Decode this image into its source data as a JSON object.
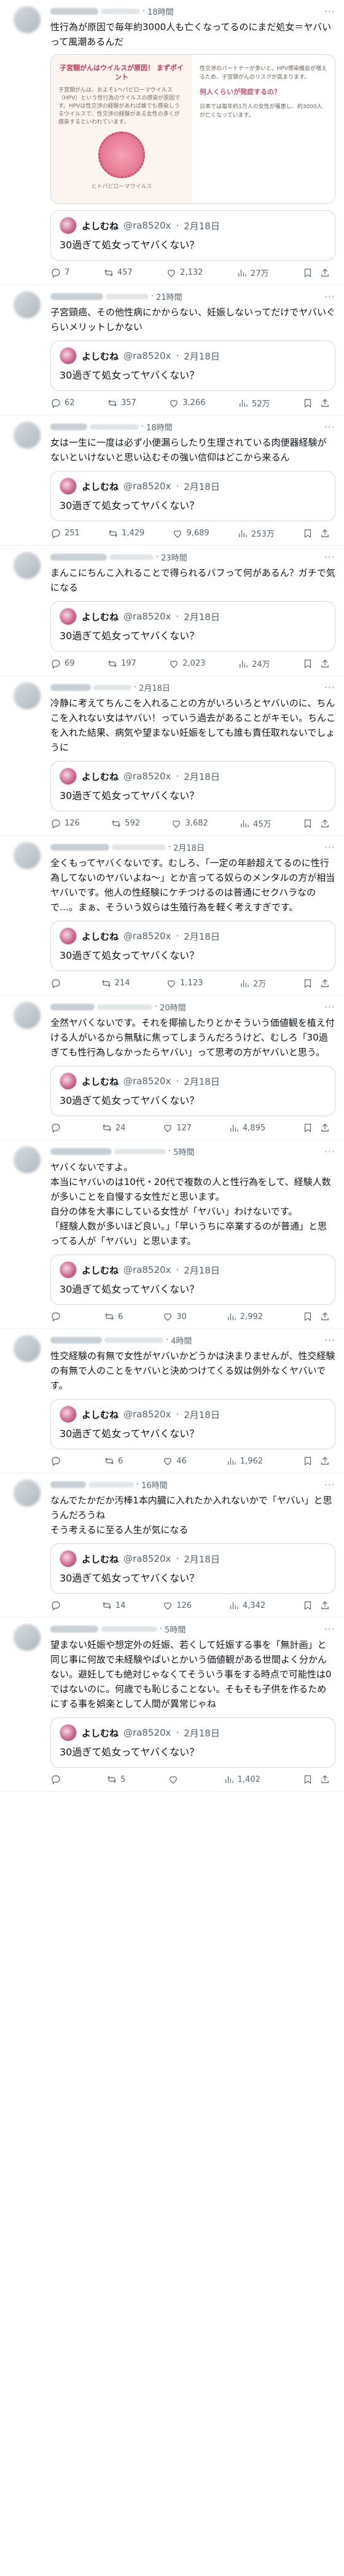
{
  "ui": {
    "quoted_name": "よしむね",
    "quoted_handle": "@ra8520x",
    "quoted_date": "2月18日",
    "quoted_text": "30過ぎて処女ってヤバくない？",
    "separator": "·"
  },
  "image_card": {
    "left_title": "子宮頸がんはウイルスが原因！\nまずポイント",
    "left_body": "子宮頸がんは、およそ1ヘパビローマウイルス（HPV）という性行為のウイルスの感染が原因です。HPVは性交渉の経験があれば誰でも感染しうるウイルスで、性交渉の経験がある女性の多くが感染するといわれています。",
    "caption": "ヒトパピローマウイルス",
    "right_body_1": "性交渉のパートナーが多いと、HPV感染機会が増えるため、子宮頸がんのリスクが高まります。",
    "right_pink": "何人くらいが発症するの？",
    "right_body_2": "日本では毎年約1万人の女性が罹患し、約3000人が亡くなっています。"
  },
  "posts": [
    {
      "time": "18時間",
      "text": "性行為が原因で毎年約3000人も亡くなってるのにまだ処女＝ヤバいって風潮あるんだ",
      "replies": "7",
      "reposts": "457",
      "likes": "2,132",
      "views": "27万"
    },
    {
      "time": "21時間",
      "text": "子宮頸癌、その他性病にかからない、妊娠しないってだけでヤバいぐらいメリットしかない",
      "replies": "62",
      "reposts": "357",
      "likes": "3,266",
      "views": "52万"
    },
    {
      "time": "18時間",
      "text": "女は一生に一度は必ず小便漏らしたり生理されている肉便器経験がないといけないと思い込むその強い信仰はどこから来るん",
      "replies": "251",
      "reposts": "1,429",
      "likes": "9,689",
      "views": "253万"
    },
    {
      "time": "23時間",
      "text": "まんこにちんこ入れることで得られるバフって何があるん？ガチで気になる",
      "replies": "69",
      "reposts": "197",
      "likes": "2,023",
      "views": "24万"
    },
    {
      "time": "2月18日",
      "text": "冷静に考えてちんこを入れることの方がいろいろとヤバいのに、ちんこを入れない女はヤバい！っていう過去があることがキモい。ちんこを入れた結果、病気や望まない妊娠をしても誰も責任取れないでしょうに",
      "replies": "126",
      "reposts": "592",
      "likes": "3,682",
      "views": "45万"
    },
    {
      "time": "2月18日",
      "text": "全くもってヤバくないです。むしろ、「一定の年齢超えてるのに性行為してないのヤバいよね～」とか言ってる奴らのメンタルの方が相当ヤバいです。他人の性経験にケチつけるのは普通にセクハラなので…。まぁ、そういう奴らは生殖行為を軽く考えすぎです。",
      "replies": "",
      "reposts": "214",
      "likes": "1,123",
      "views": "2万"
    },
    {
      "time": "20時間",
      "text": "全然ヤバくないです。それを揶揄したりとかそういう価値観を植え付ける人がいるから無駄に焦ってしまうんだろうけど、むしろ「30過ぎても性行為しなかったらヤバい」って思考の方がヤバいと思う。",
      "replies": "",
      "reposts": "24",
      "likes": "127",
      "views": "4,895"
    },
    {
      "time": "5時間",
      "text": "ヤバくないですよ。\n本当にヤバいのは10代・20代で複数の人と性行為をして、経験人数が多いことを自慢する女性だと思います。\n自分の体を大事にしている女性が「ヤバい」わけないです。\n「経験人数が多いほど良い。」「早いうちに卒業するのが普通」と思ってる人が「ヤバい」と思います。",
      "replies": "",
      "reposts": "6",
      "likes": "30",
      "views": "2,992"
    },
    {
      "time": "4時間",
      "text": "性交経験の有無で女性がヤバいかどうかは決まりませんが、性交経験の有無で人のことをヤバいと決めつけてくる奴は例外なくヤバいです。",
      "replies": "",
      "reposts": "6",
      "likes": "46",
      "views": "1,962"
    },
    {
      "time": "16時間",
      "text": "なんでたかだか汚棒1本内臓に入れたか入れないかで「ヤバい」と思うんだろうね\nそう考えるに至る人生が気になる",
      "replies": "",
      "reposts": "14",
      "likes": "126",
      "views": "4,342"
    },
    {
      "time": "5時間",
      "text": "望まない妊娠や想定外の妊娠、若くして妊娠する事を「無計画」と同じ事に何故で未経験やぱいとかいう価値観がある世間よく分かんない。避妊しても絶対じゃなくてそういう事をする時点で可能性は0ではないのに。何歳でも恥じることない。そもそも子供を作るためにする事を娯楽として人間が異常じゃね",
      "replies": "",
      "reposts": "5",
      "likes": "",
      "views": "1,402"
    }
  ]
}
